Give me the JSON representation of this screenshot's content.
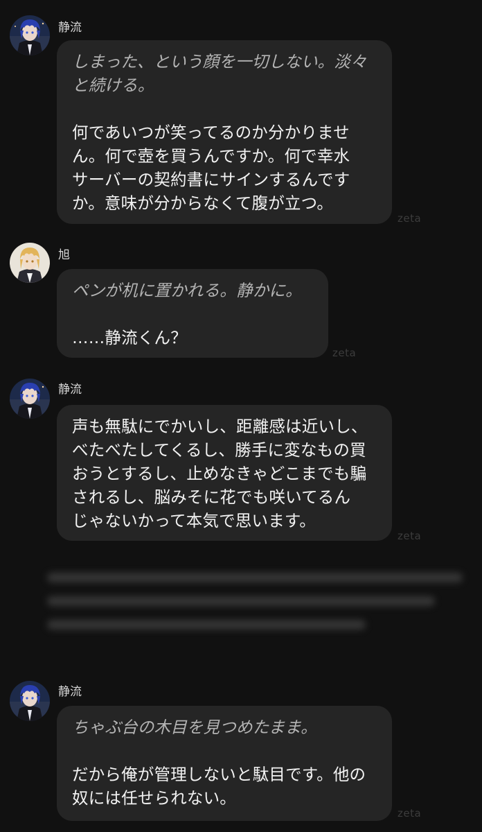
{
  "messages": [
    {
      "name": "静流",
      "avatar": "shizuru-avatar",
      "italic": "しまった、という顔を一切しない。淡々\nと続ける。",
      "text": "何であいつが笑ってるのか分かりませ\nん。何で壺を買うんですか。何で幸水\nサーバーの契約書にサインするんです\nか。意味が分からなくて腹が立つ。",
      "watermark": "zeta"
    },
    {
      "name": "旭",
      "avatar": "asahi-avatar",
      "italic": "ペンが机に置かれる。静かに。",
      "text": "……静流くん？",
      "watermark": "zeta"
    },
    {
      "name": "静流",
      "avatar": "shizuru-avatar",
      "italic": "",
      "text": "声も無駄にでかいし、距離感は近いし、\nべたべたしてくるし、勝手に変なもの買\nおうとするし、止めなきゃどこまでも騙\nされるし、脳みそに花でも咲いてるん\nじゃないかって本気で思います。",
      "watermark": "zeta"
    },
    {
      "name": "静流",
      "avatar": "shizuru-avatar",
      "italic": "ちゃぶ台の木目を見つめたまま。",
      "text": "だから俺が管理しないと駄目です。他の\n奴には任せられない。",
      "watermark": "zeta"
    }
  ],
  "colors": {
    "background": "#111111",
    "bubble": "#252525",
    "italic_text": "#b4b4b4",
    "text": "#f2f2f2",
    "watermark": "#3c3c3c"
  }
}
